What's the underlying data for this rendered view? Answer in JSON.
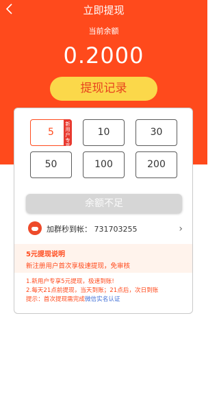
{
  "header": {
    "title": "立即提现",
    "balance_label": "当前余额",
    "balance_value": "0.2000",
    "record_button": "提现记录"
  },
  "amounts": [
    {
      "value": "5",
      "selected": true,
      "tag": "新用户专享"
    },
    {
      "value": "10",
      "selected": false
    },
    {
      "value": "30",
      "selected": false
    },
    {
      "value": "50",
      "selected": false
    },
    {
      "value": "100",
      "selected": false
    },
    {
      "value": "200",
      "selected": false
    }
  ],
  "insufficient_button": "余额不足",
  "group": {
    "label": "加群秒到帐：  731703255",
    "arrow": "›"
  },
  "notice": {
    "title": "5元提现说明",
    "text": "新注册用户首次享极速提现，免审核"
  },
  "rules": {
    "line1": "1.新用户专享5元提现，极速到账!",
    "line2": "2.每天21点前提现，当天到账；21点后，次日到账",
    "line3_prefix": "提示：首次提现需完成",
    "line3_link": "微信实名认证"
  },
  "colors": {
    "primary": "#ff4a1c",
    "record_button_bg": "#fbd84a",
    "link": "#3d6dd6"
  }
}
